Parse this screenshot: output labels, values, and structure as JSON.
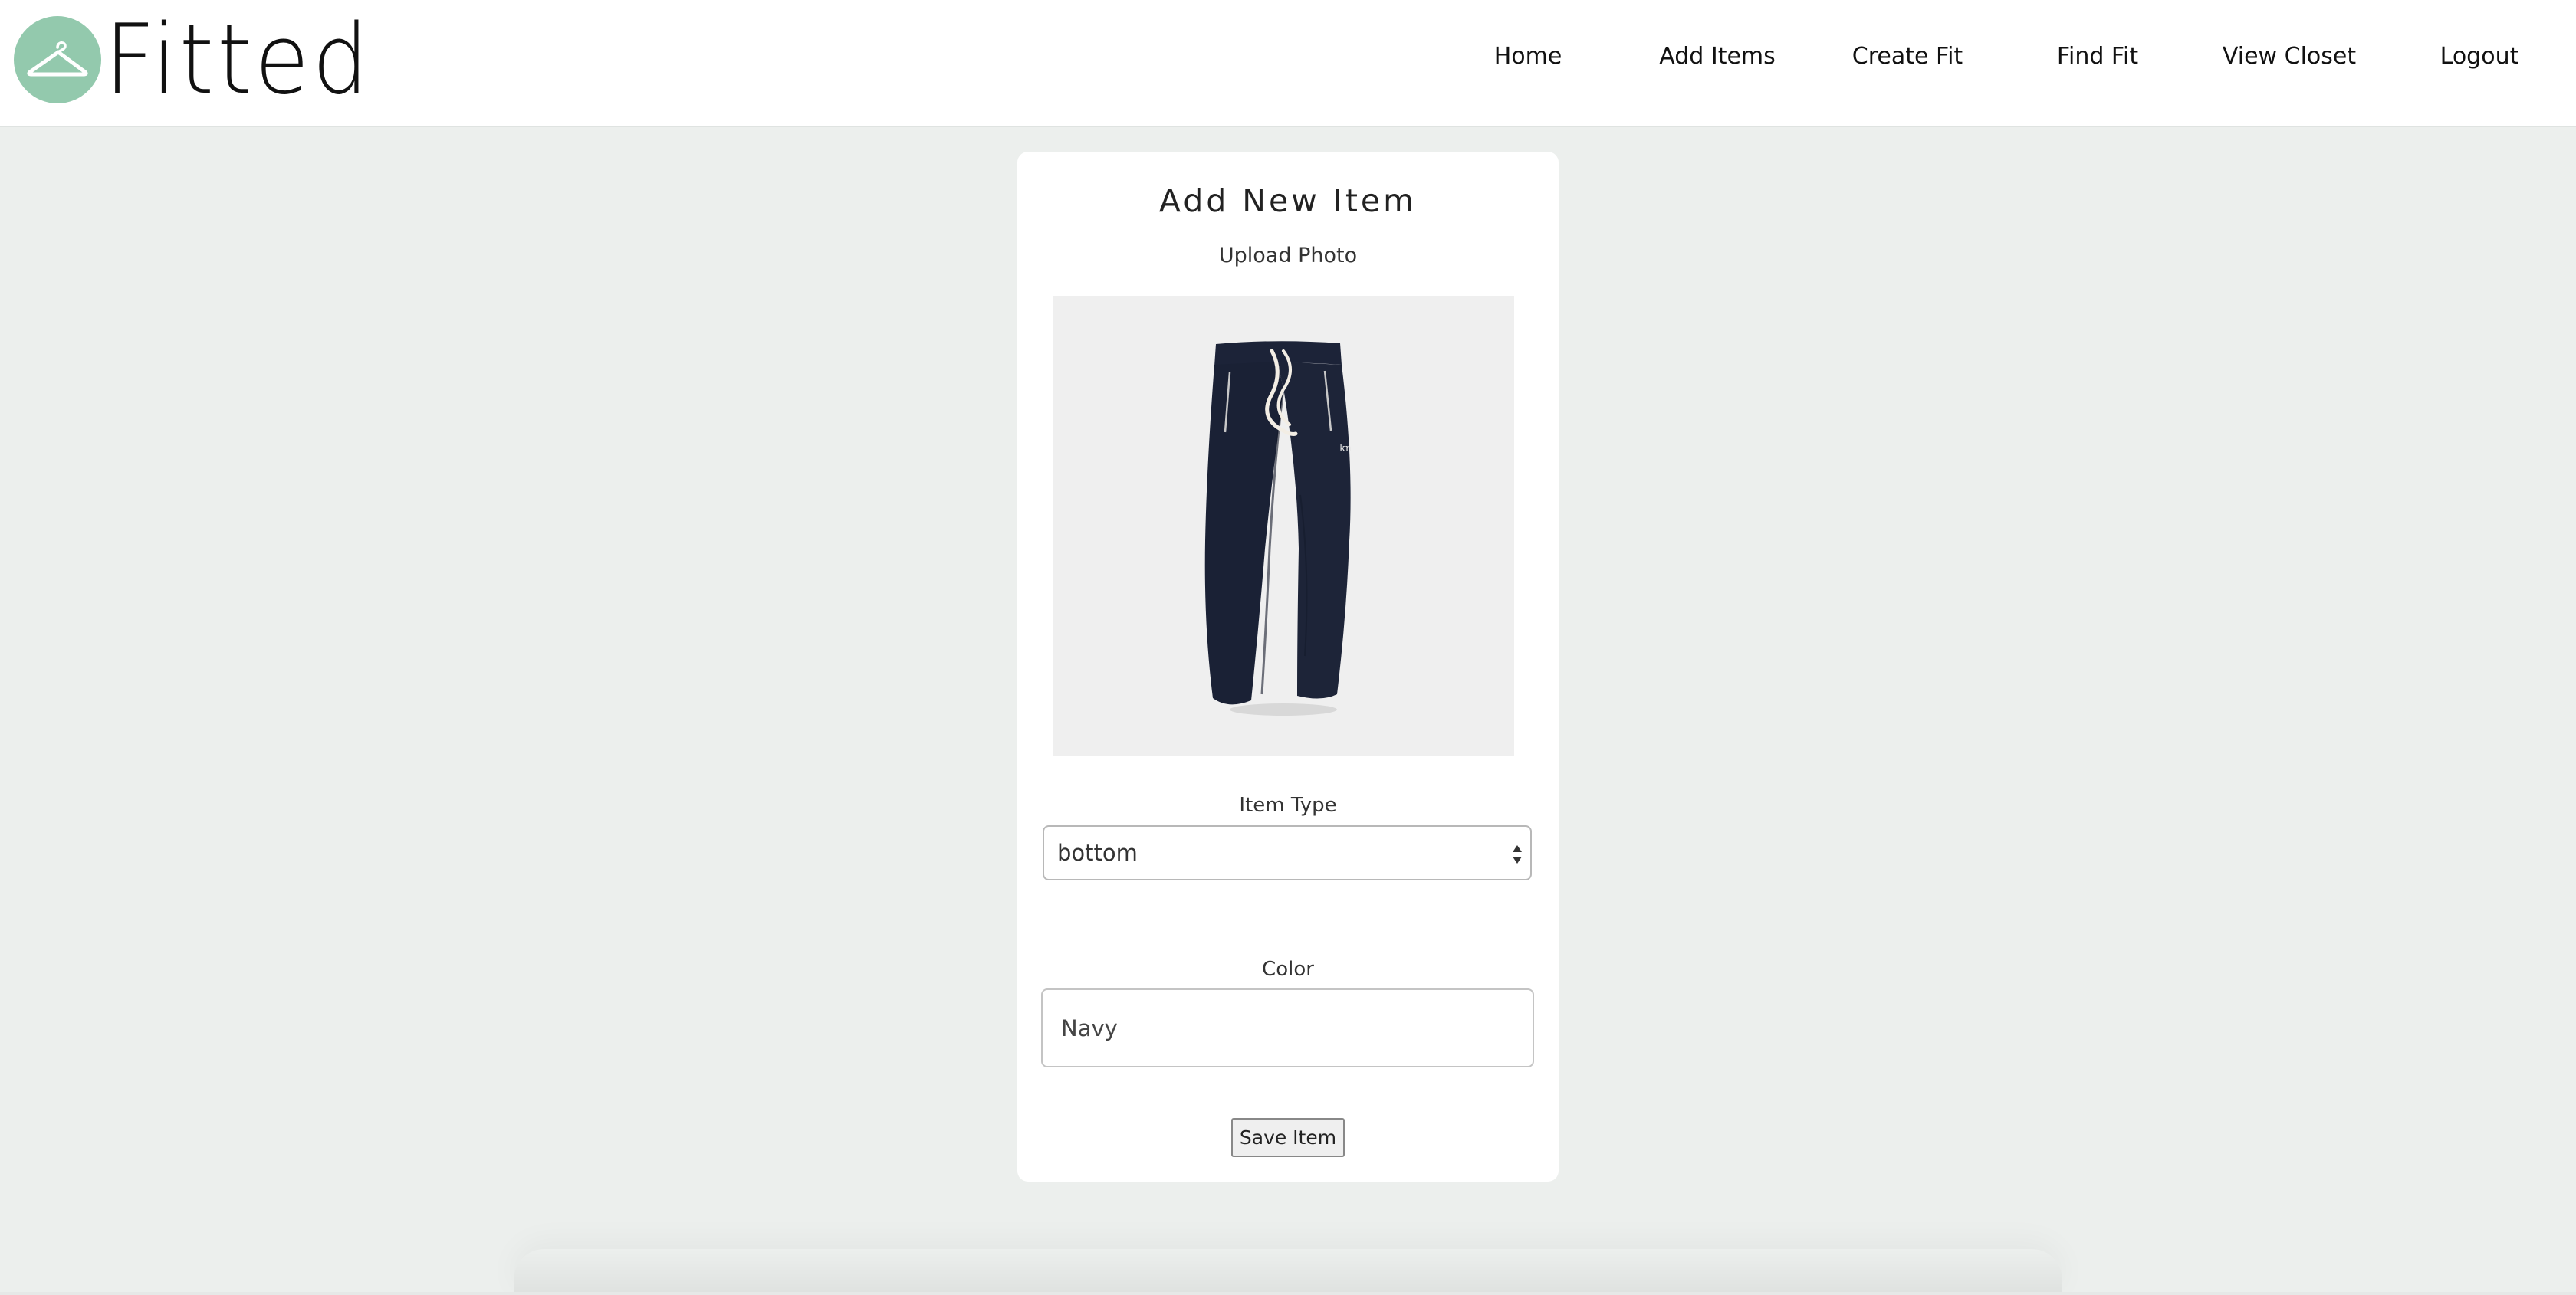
{
  "app": {
    "brand_name": "Fitted",
    "brand_color": "#93c9ad",
    "logo_icon": "clothes-hanger-icon"
  },
  "nav": {
    "items": [
      {
        "label": "Home"
      },
      {
        "label": "Add Items"
      },
      {
        "label": "Create Fit"
      },
      {
        "label": "Find Fit"
      },
      {
        "label": "View Closet"
      },
      {
        "label": "Logout"
      }
    ]
  },
  "form": {
    "title": "Add New Item",
    "upload_label": "Upload Photo",
    "photo_description": "navy-jogger-pants-photo",
    "item_type_label": "Item Type",
    "item_type_value": "bottom",
    "color_label": "Color",
    "color_value": "Navy",
    "save_label": "Save Item"
  },
  "colors": {
    "background": "#ecefed",
    "card": "#ffffff",
    "pants": "#1a2135"
  }
}
